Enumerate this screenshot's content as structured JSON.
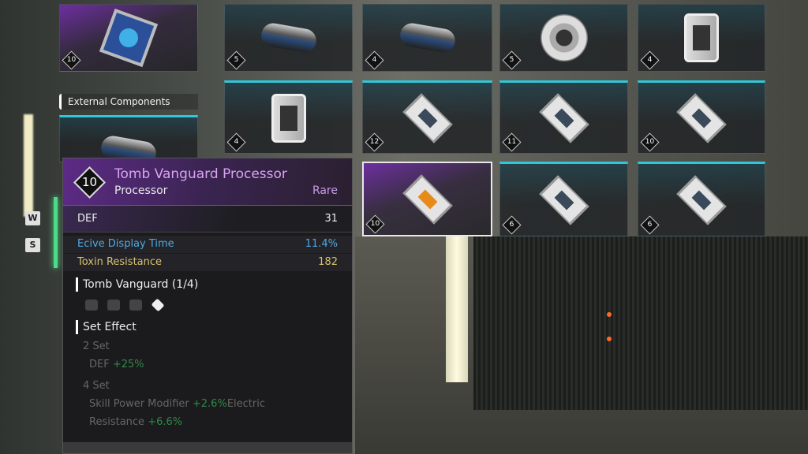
{
  "inventory": {
    "left_tiles": [
      {
        "level": "10",
        "rarity": "purple",
        "item": "star-component"
      },
      {
        "level": "",
        "rarity": "teal",
        "item": "cylinder-component"
      }
    ],
    "section_label": "External Components",
    "grid": [
      [
        {
          "level": "5",
          "item": "cylinder"
        },
        {
          "level": "4",
          "item": "cylinder"
        },
        {
          "level": "5",
          "item": "ring"
        },
        {
          "level": "4",
          "item": "box"
        }
      ],
      [
        {
          "level": "4",
          "item": "box"
        },
        {
          "level": "12",
          "item": "chip"
        },
        {
          "level": "11",
          "item": "chip"
        },
        {
          "level": "10",
          "item": "chip"
        }
      ],
      [
        {
          "level": "10",
          "item": "chip-orange",
          "selected": true
        },
        {
          "level": "6",
          "item": "chip"
        },
        {
          "level": "6",
          "item": "chip"
        }
      ]
    ]
  },
  "keys": {
    "up": "W",
    "down": "S"
  },
  "tooltip": {
    "level": "10",
    "name": "Tomb Vanguard Processor",
    "type": "Processor",
    "rarity": "Rare",
    "main_stat": {
      "label": "DEF",
      "value": "31"
    },
    "sub_stats": [
      {
        "label": "Ecive Display Time",
        "value": "11.4%",
        "color": "#4fa8e0"
      },
      {
        "label": "Toxin Resistance",
        "value": "182",
        "color": "#d8c070"
      }
    ],
    "set_name": "Tomb Vanguard (1/4)",
    "set_effect_label": "Set Effect",
    "set2": {
      "label": "2 Set",
      "stat": "DEF",
      "bonus": "+25%"
    },
    "set4": {
      "label": "4 Set",
      "stat1": "Skill Power Modifier",
      "bonus1": "+2.6%",
      "stat2a": "Electric",
      "stat2b": "Resistance",
      "bonus2": "+6.6%"
    }
  },
  "colors": {
    "rare": "#c89ae6",
    "teal": "#2fc7d9",
    "bonus": "#2e8a46"
  }
}
